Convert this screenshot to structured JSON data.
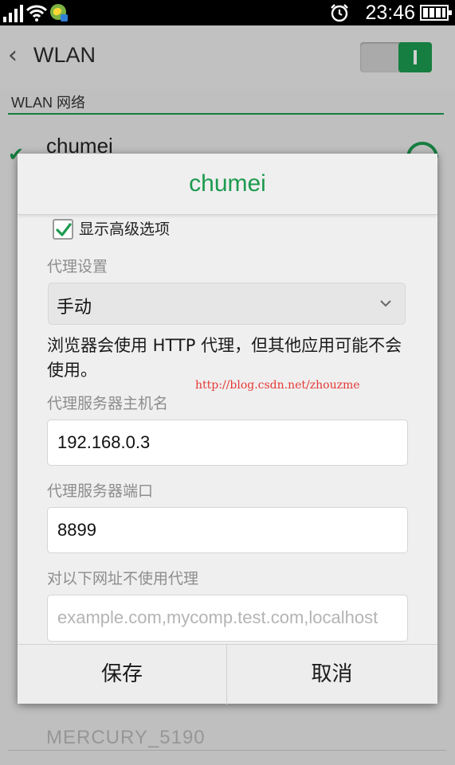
{
  "status_bar": {
    "time": "23:46"
  },
  "app_bar": {
    "back_glyph": "‹",
    "title": "WLAN",
    "wlan_toggle": "on"
  },
  "section_header": "WLAN 网络",
  "background": {
    "connected_network": "chumei",
    "partial_network": "MERCURY_5190"
  },
  "dialog": {
    "title": "chumei",
    "advanced_checkbox": {
      "label": "显示高级选项",
      "checked": true
    },
    "proxy_settings": {
      "label": "代理设置",
      "selected": "手动"
    },
    "notice": "浏览器会使用 HTTP 代理，但其他应用可能不会使用。",
    "watermark": "http://blog.csdn.net/zhouzme",
    "hostname": {
      "label": "代理服务器主机名",
      "value": "192.168.0.3"
    },
    "port": {
      "label": "代理服务器端口",
      "value": "8899"
    },
    "bypass": {
      "label": "对以下网址不使用代理",
      "placeholder": "example.com,mycomp.test.com,localhost"
    },
    "save_button": "保存",
    "cancel_button": "取消"
  },
  "colors": {
    "accent": "#1c9a4f",
    "watermark": "#e53935"
  }
}
